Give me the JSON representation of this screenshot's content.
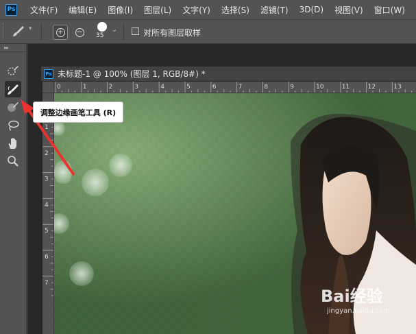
{
  "app": {
    "logo": "Ps"
  },
  "menu": [
    "文件(F)",
    "编辑(E)",
    "图像(I)",
    "图层(L)",
    "文字(Y)",
    "选择(S)",
    "滤镜(T)",
    "3D(D)",
    "视图(V)",
    "窗口(W)"
  ],
  "options": {
    "brush_size": "35",
    "sample_all_layers_label": "对所有图层取样",
    "sample_all_layers_checked": false
  },
  "document": {
    "tab_title": "未标题-1 @ 100% (图层 1, RGB/8#) *"
  },
  "rulers": {
    "horizontal": [
      "0",
      "1",
      "2",
      "3",
      "4",
      "5",
      "6",
      "7",
      "8",
      "9",
      "10",
      "11",
      "12",
      "13"
    ],
    "vertical": [
      "1",
      "2",
      "3",
      "4",
      "5",
      "6",
      "7"
    ]
  },
  "tooltip": {
    "text": "调整边缘画笔工具 (R)"
  },
  "tools": [
    "quick-selection-icon",
    "refine-edge-brush-icon",
    "brush-icon",
    "lasso-icon",
    "hand-icon",
    "zoom-icon"
  ],
  "watermark": {
    "text": "Bai经验",
    "sub": "jingyan.baidu.com"
  },
  "colors": {
    "accent": "#31a8ff",
    "arrow": "#e8332f"
  }
}
